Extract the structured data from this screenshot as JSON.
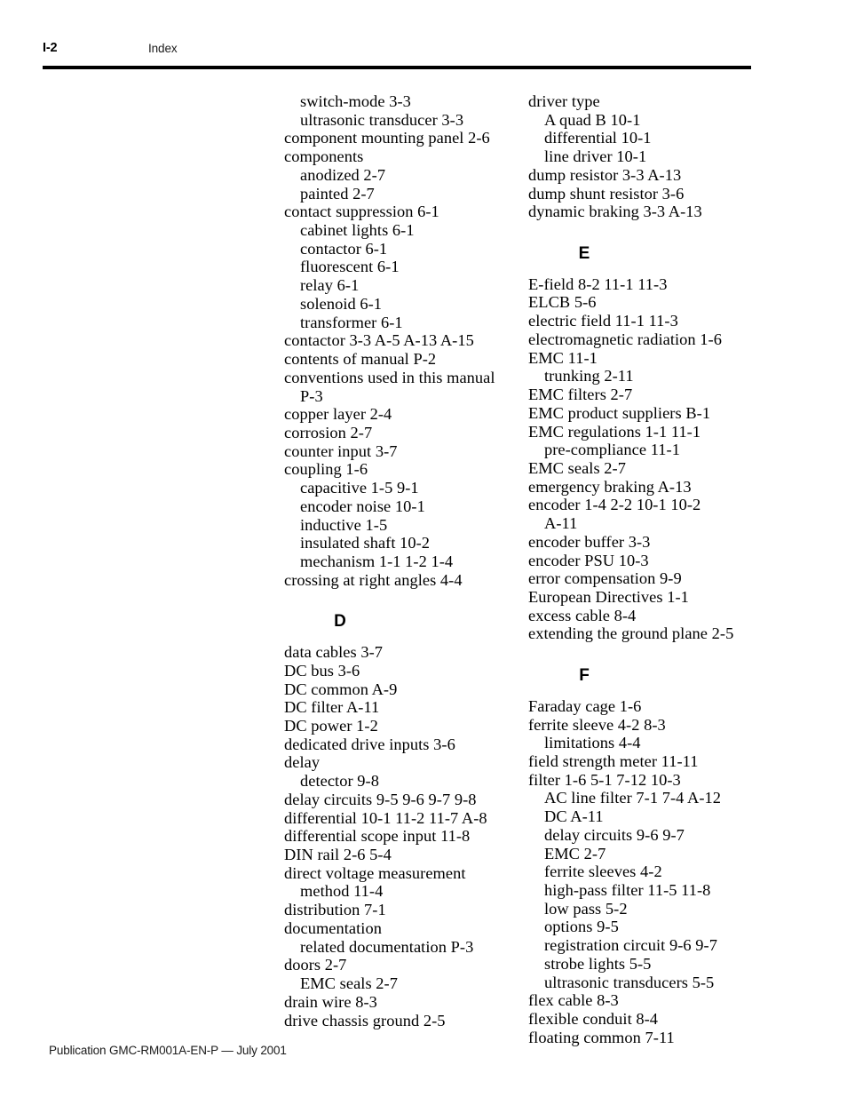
{
  "header": {
    "folio": "I-2",
    "title": "Index"
  },
  "footer": {
    "text": "Publication GMC-RM001A-EN-P — July 2001"
  },
  "columns": {
    "left": [
      {
        "kind": "entry",
        "level": 1,
        "text": "switch-mode 3-3"
      },
      {
        "kind": "entry",
        "level": 1,
        "text": "ultrasonic transducer 3-3"
      },
      {
        "kind": "entry",
        "level": 0,
        "text": "component mounting panel 2-6"
      },
      {
        "kind": "entry",
        "level": 0,
        "text": "components"
      },
      {
        "kind": "entry",
        "level": 1,
        "text": "anodized 2-7"
      },
      {
        "kind": "entry",
        "level": 1,
        "text": "painted 2-7"
      },
      {
        "kind": "entry",
        "level": 0,
        "text": "contact suppression 6-1"
      },
      {
        "kind": "entry",
        "level": 1,
        "text": "cabinet lights 6-1"
      },
      {
        "kind": "entry",
        "level": 1,
        "text": "contactor 6-1"
      },
      {
        "kind": "entry",
        "level": 1,
        "text": "fluorescent 6-1"
      },
      {
        "kind": "entry",
        "level": 1,
        "text": "relay 6-1"
      },
      {
        "kind": "entry",
        "level": 1,
        "text": "solenoid 6-1"
      },
      {
        "kind": "entry",
        "level": 1,
        "text": "transformer 6-1"
      },
      {
        "kind": "entry",
        "level": 0,
        "text": "contactor 3-3  A-5  A-13  A-15"
      },
      {
        "kind": "entry",
        "level": 0,
        "text": "contents of manual P-2"
      },
      {
        "kind": "entry",
        "level": 0,
        "text": "conventions used in this manual"
      },
      {
        "kind": "turnover",
        "level": 0,
        "text": "P-3"
      },
      {
        "kind": "entry",
        "level": 0,
        "text": "copper layer 2-4"
      },
      {
        "kind": "entry",
        "level": 0,
        "text": "corrosion 2-7"
      },
      {
        "kind": "entry",
        "level": 0,
        "text": "counter input 3-7"
      },
      {
        "kind": "entry",
        "level": 0,
        "text": "coupling 1-6"
      },
      {
        "kind": "entry",
        "level": 1,
        "text": "capacitive 1-5  9-1"
      },
      {
        "kind": "entry",
        "level": 1,
        "text": "encoder noise 10-1"
      },
      {
        "kind": "entry",
        "level": 1,
        "text": "inductive 1-5"
      },
      {
        "kind": "entry",
        "level": 1,
        "text": "insulated shaft 10-2"
      },
      {
        "kind": "entry",
        "level": 1,
        "text": "mechanism 1-1  1-2  1-4"
      },
      {
        "kind": "entry",
        "level": 0,
        "text": "crossing at right angles 4-4"
      },
      {
        "kind": "letter",
        "text": "D"
      },
      {
        "kind": "entry",
        "level": 0,
        "text": "data cables 3-7"
      },
      {
        "kind": "entry",
        "level": 0,
        "text": "DC bus 3-6"
      },
      {
        "kind": "entry",
        "level": 0,
        "text": "DC common A-9"
      },
      {
        "kind": "entry",
        "level": 0,
        "text": "DC filter A-11"
      },
      {
        "kind": "entry",
        "level": 0,
        "text": "DC power 1-2"
      },
      {
        "kind": "entry",
        "level": 0,
        "text": "dedicated drive inputs 3-6"
      },
      {
        "kind": "entry",
        "level": 0,
        "text": "delay"
      },
      {
        "kind": "entry",
        "level": 1,
        "text": "detector 9-8"
      },
      {
        "kind": "entry",
        "level": 0,
        "text": "delay circuits 9-5  9-6  9-7  9-8"
      },
      {
        "kind": "entry",
        "level": 0,
        "text": "differential 10-1  11-2  11-7  A-8"
      },
      {
        "kind": "entry",
        "level": 0,
        "text": "differential scope input 11-8"
      },
      {
        "kind": "entry",
        "level": 0,
        "text": "DIN rail 2-6  5-4"
      },
      {
        "kind": "entry",
        "level": 0,
        "text": "direct voltage measurement"
      },
      {
        "kind": "turnover",
        "level": 0,
        "text": "method 11-4"
      },
      {
        "kind": "entry",
        "level": 0,
        "text": "distribution 7-1"
      },
      {
        "kind": "entry",
        "level": 0,
        "text": "documentation"
      },
      {
        "kind": "entry",
        "level": 1,
        "text": "related documentation P-3"
      },
      {
        "kind": "entry",
        "level": 0,
        "text": "doors 2-7"
      },
      {
        "kind": "entry",
        "level": 1,
        "text": "EMC seals 2-7"
      },
      {
        "kind": "entry",
        "level": 0,
        "text": "drain wire 8-3"
      },
      {
        "kind": "entry",
        "level": 0,
        "text": "drive chassis ground 2-5"
      }
    ],
    "right": [
      {
        "kind": "entry",
        "level": 0,
        "text": "driver type"
      },
      {
        "kind": "entry",
        "level": 1,
        "text": "A quad B 10-1"
      },
      {
        "kind": "entry",
        "level": 1,
        "text": "differential 10-1"
      },
      {
        "kind": "entry",
        "level": 1,
        "text": "line driver 10-1"
      },
      {
        "kind": "entry",
        "level": 0,
        "text": "dump resistor 3-3  A-13"
      },
      {
        "kind": "entry",
        "level": 0,
        "text": "dump shunt resistor 3-6"
      },
      {
        "kind": "entry",
        "level": 0,
        "text": "dynamic braking 3-3  A-13"
      },
      {
        "kind": "letter",
        "text": "E"
      },
      {
        "kind": "entry",
        "level": 0,
        "text": "E-field 8-2  11-1  11-3"
      },
      {
        "kind": "entry",
        "level": 0,
        "text": "ELCB 5-6"
      },
      {
        "kind": "entry",
        "level": 0,
        "text": "electric field 11-1  11-3"
      },
      {
        "kind": "entry",
        "level": 0,
        "text": "electromagnetic radiation 1-6"
      },
      {
        "kind": "entry",
        "level": 0,
        "text": "EMC 11-1"
      },
      {
        "kind": "entry",
        "level": 1,
        "text": "trunking 2-11"
      },
      {
        "kind": "entry",
        "level": 0,
        "text": "EMC filters 2-7"
      },
      {
        "kind": "entry",
        "level": 0,
        "text": "EMC product suppliers B-1"
      },
      {
        "kind": "entry",
        "level": 0,
        "text": "EMC regulations 1-1  11-1"
      },
      {
        "kind": "entry",
        "level": 1,
        "text": "pre-compliance 11-1"
      },
      {
        "kind": "entry",
        "level": 0,
        "text": "EMC seals 2-7"
      },
      {
        "kind": "entry",
        "level": 0,
        "text": "emergency braking A-13"
      },
      {
        "kind": "entry",
        "level": 0,
        "text": "encoder 1-4  2-2  10-1  10-2"
      },
      {
        "kind": "turnover",
        "level": 0,
        "text": "A-11"
      },
      {
        "kind": "entry",
        "level": 0,
        "text": "encoder buffer 3-3"
      },
      {
        "kind": "entry",
        "level": 0,
        "text": "encoder PSU 10-3"
      },
      {
        "kind": "entry",
        "level": 0,
        "text": "error compensation 9-9"
      },
      {
        "kind": "entry",
        "level": 0,
        "text": "European Directives 1-1"
      },
      {
        "kind": "entry",
        "level": 0,
        "text": "excess cable 8-4"
      },
      {
        "kind": "entry",
        "level": 0,
        "text": "extending the ground plane 2-5"
      },
      {
        "kind": "letter",
        "text": "F"
      },
      {
        "kind": "entry",
        "level": 0,
        "text": "Faraday cage 1-6"
      },
      {
        "kind": "entry",
        "level": 0,
        "text": "ferrite sleeve 4-2  8-3"
      },
      {
        "kind": "entry",
        "level": 1,
        "text": "limitations 4-4"
      },
      {
        "kind": "entry",
        "level": 0,
        "text": "field strength meter 11-11"
      },
      {
        "kind": "entry",
        "level": 0,
        "text": "filter 1-6  5-1  7-12  10-3"
      },
      {
        "kind": "entry",
        "level": 1,
        "text": "AC line filter 7-1  7-4  A-12"
      },
      {
        "kind": "entry",
        "level": 1,
        "text": "DC A-11"
      },
      {
        "kind": "entry",
        "level": 1,
        "text": "delay circuits 9-6  9-7"
      },
      {
        "kind": "entry",
        "level": 1,
        "text": "EMC 2-7"
      },
      {
        "kind": "entry",
        "level": 1,
        "text": "ferrite sleeves 4-2"
      },
      {
        "kind": "entry",
        "level": 1,
        "text": "high-pass filter 11-5  11-8"
      },
      {
        "kind": "entry",
        "level": 1,
        "text": "low pass 5-2"
      },
      {
        "kind": "entry",
        "level": 1,
        "text": "options 9-5"
      },
      {
        "kind": "entry",
        "level": 1,
        "text": "registration circuit 9-6  9-7"
      },
      {
        "kind": "entry",
        "level": 1,
        "text": "strobe lights 5-5"
      },
      {
        "kind": "entry",
        "level": 1,
        "text": "ultrasonic transducers 5-5"
      },
      {
        "kind": "entry",
        "level": 0,
        "text": "flex cable 8-3"
      },
      {
        "kind": "entry",
        "level": 0,
        "text": "flexible conduit 8-4"
      },
      {
        "kind": "entry",
        "level": 0,
        "text": "floating common 7-11"
      }
    ]
  }
}
